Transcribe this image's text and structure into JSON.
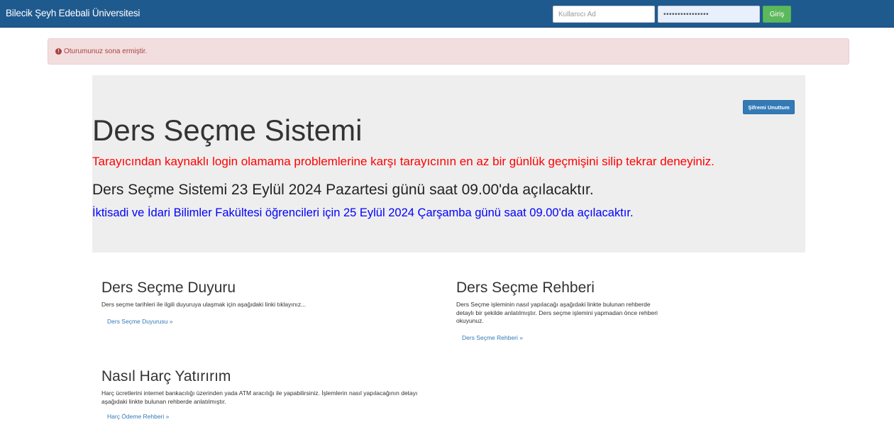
{
  "navbar": {
    "brand": "Bilecik Şeyh Edebali Üniversitesi",
    "username_placeholder": "Kullanıcı Ad",
    "password_value": "••••••••••••••••",
    "login_label": "Giriş"
  },
  "alert": {
    "icon": "exclamation-circle-icon",
    "text": "Oturumunuz sona ermiştir."
  },
  "jumbotron": {
    "forgot_button": "Şifremi Unuttum",
    "title": "Ders Seçme Sistemi",
    "warning": "Tarayıcından kaynaklı login olamama problemlerine karşı tarayıcının en az bir günlük geçmişini silip tekrar deneyiniz.",
    "opening": "Ders Seçme Sistemi 23 Eylül 2024 Pazartesi günü saat 09.00'da açılacaktır.",
    "iibf_notice": "İktisadi ve İdari Bilimler Fakültesi öğrencileri için 25 Eylül 2024 Çarşamba günü saat 09.00'da açılacaktır."
  },
  "cards": {
    "duyuru": {
      "title": "Ders Seçme Duyuru",
      "text": "Ders seçme tarihleri ile ilgili duyuruya ulaşmak için aşağıdaki linki tıklayınız...",
      "link": "Ders Seçme Duyurusu »"
    },
    "rehber": {
      "title": "Ders Seçme Rehberi",
      "text": "Ders Seçme işleminin nasıl yapılacağı aşağıdaki linkte bulunan rehberde detaylı bir şekilde anlatılmıştır. Ders seçme işlemini yapmadan önce rehberi okuyunuz.",
      "link": "Ders Seçme Rehberi »"
    },
    "harc": {
      "title": "Nasıl Harç Yatırırım",
      "text": "Harç ücretlerini internet bankacılığı üzerinden yada ATM aracılığı ile yapabilirsiniz. İşlemlerin nasıl yapılacağının detayı aşağıdaki linkte bulunan rehberde anlatılmıştır.",
      "link": "Harç Ödeme Rehberi »"
    }
  },
  "colors": {
    "navbar": "#1f5a8f",
    "login_button": "#5cb85c",
    "alert_bg": "#f2dede",
    "alert_text": "#a94442",
    "jumbotron_bg": "#eeeeee",
    "warning_text": "#ff0000",
    "notice_text": "#0000ff",
    "link": "#337ab7"
  }
}
